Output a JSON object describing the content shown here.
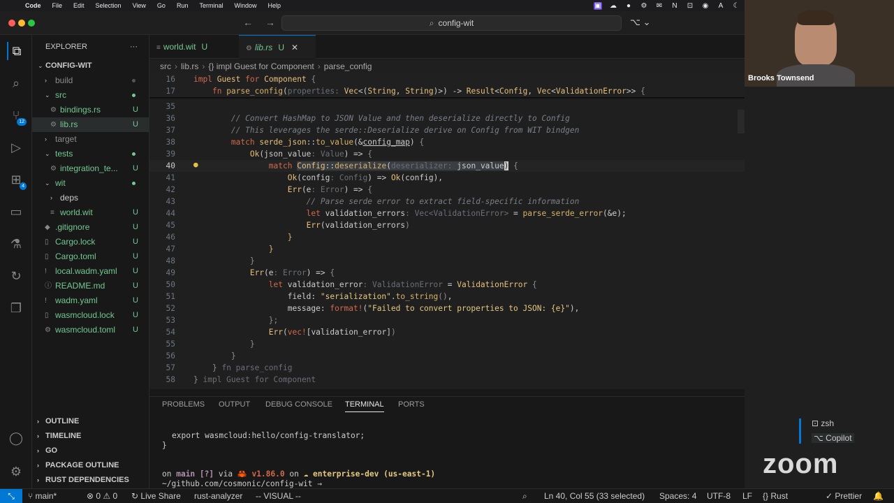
{
  "menubar": {
    "app": "Code",
    "items": [
      "File",
      "Edit",
      "Selection",
      "View",
      "Go",
      "Run",
      "Terminal",
      "Window",
      "Help"
    ]
  },
  "titlebar": {
    "back": "←",
    "forward": "→",
    "search": "config-wit",
    "copilot": "⌥ ⌄"
  },
  "activity_badges": {
    "source_control": "12",
    "extensions": "4"
  },
  "explorer": {
    "title": "EXPLORER",
    "more": "···",
    "root": "CONFIG-WIT",
    "tree": [
      {
        "label": "build",
        "status": ""
      },
      {
        "label": "src",
        "status": ""
      },
      {
        "label": "bindings.rs",
        "status": "U"
      },
      {
        "label": "lib.rs",
        "status": "U"
      },
      {
        "label": "target",
        "status": ""
      },
      {
        "label": "tests",
        "status": ""
      },
      {
        "label": "integration_te...",
        "status": "U"
      },
      {
        "label": "wit",
        "status": ""
      },
      {
        "label": "deps",
        "status": ""
      },
      {
        "label": "world.wit",
        "status": "U"
      },
      {
        "label": ".gitignore",
        "status": "U"
      },
      {
        "label": "Cargo.lock",
        "status": "U"
      },
      {
        "label": "Cargo.toml",
        "status": "U"
      },
      {
        "label": "local.wadm.yaml",
        "status": "U"
      },
      {
        "label": "README.md",
        "status": "U"
      },
      {
        "label": "wadm.yaml",
        "status": "U"
      },
      {
        "label": "wasmcloud.lock",
        "status": "U"
      },
      {
        "label": "wasmcloud.toml",
        "status": "U"
      }
    ],
    "sections": [
      "OUTLINE",
      "TIMELINE",
      "GO",
      "PACKAGE OUTLINE",
      "RUST DEPENDENCIES"
    ]
  },
  "tabs": [
    {
      "label": "world.wit",
      "status": "U"
    },
    {
      "label": "lib.rs",
      "status": "U",
      "close": "✕"
    }
  ],
  "breadcrumb": [
    "src",
    "lib.rs",
    "{} impl Guest for Component",
    "parse_config"
  ],
  "editor": {
    "line_numbers": [
      "16",
      "17",
      "35",
      "36",
      "37",
      "38",
      "39",
      "40",
      "41",
      "42",
      "43",
      "44",
      "45",
      "46",
      "47",
      "48",
      "49",
      "50",
      "51",
      "52",
      "53",
      "54",
      "55",
      "56",
      "57",
      "58"
    ]
  },
  "panel": {
    "tabs": [
      "PROBLEMS",
      "OUTPUT",
      "DEBUG CONSOLE",
      "TERMINAL",
      "PORTS"
    ],
    "terminal_lines": [
      "export wasmcloud:hello/config-translator;",
      "}",
      "on main [?] via 🦀 v1.86.0 on ☁ enterprise-dev (us-east-1)",
      "~/github.com/cosmonic/config-wit → "
    ],
    "terminals": [
      "zsh",
      "Copilot"
    ]
  },
  "statusbar": {
    "branch": "main*",
    "problems": "⊗ 0 ⚠ 0",
    "live_share": "Live Share",
    "analyzer": "rust-analyzer",
    "mode": "-- VISUAL --",
    "position": "Ln 40, Col 55 (33 selected)",
    "spaces": "Spaces: 4",
    "encoding": "UTF-8",
    "eol": "LF",
    "language": "Rust",
    "formatter": "Prettier"
  },
  "zoom": {
    "participant": "Brooks Townsend",
    "logo": "zoom"
  },
  "colors": {
    "accent": "#0078d4",
    "untracked": "#73c991",
    "keyword": "#d2694b"
  }
}
